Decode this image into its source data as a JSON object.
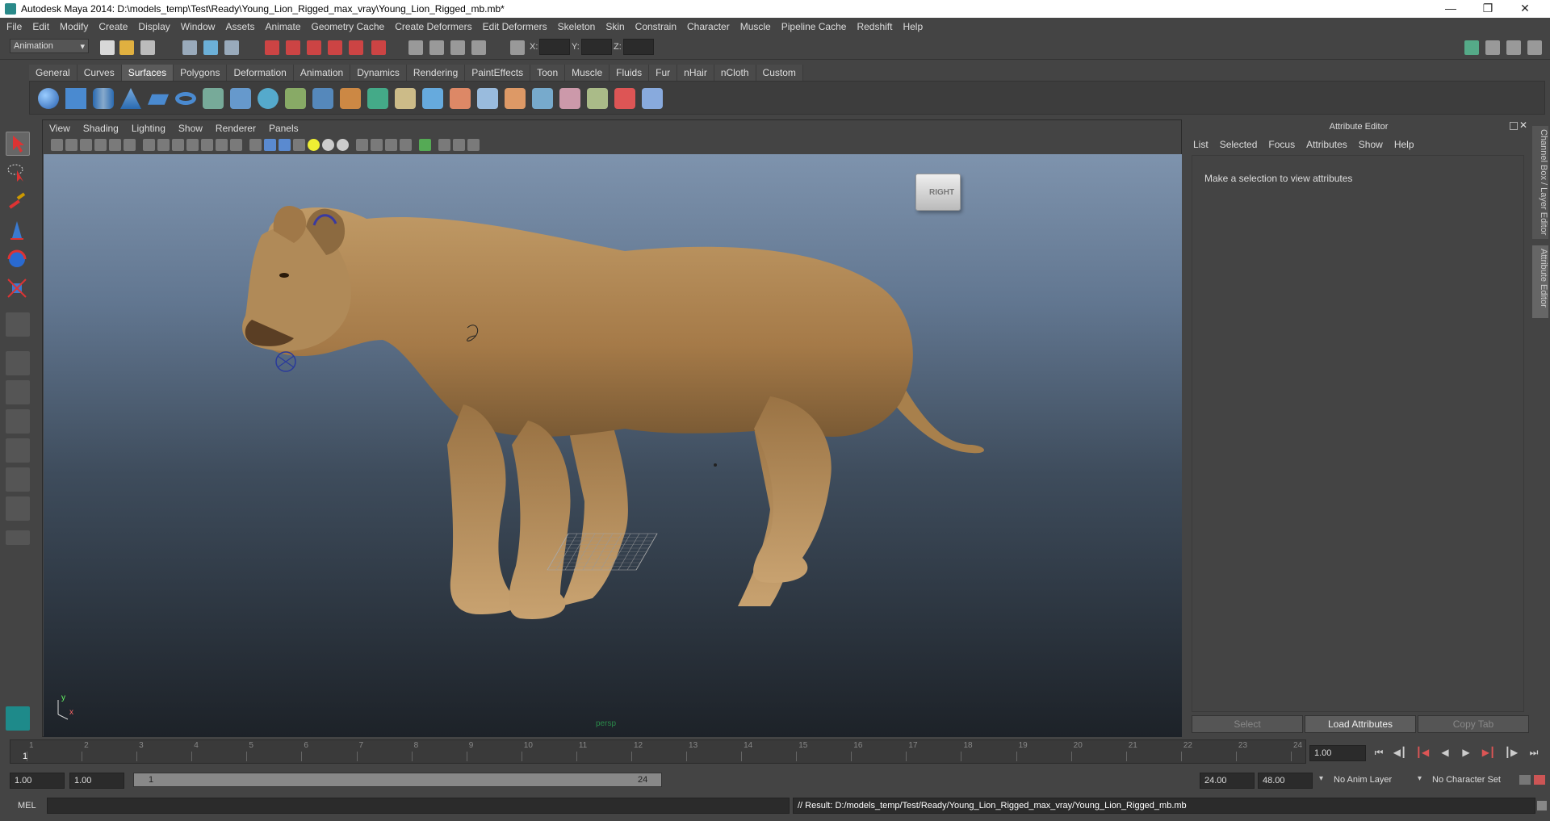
{
  "window": {
    "title": "Autodesk Maya 2014: D:\\models_temp\\Test\\Ready\\Young_Lion_Rigged_max_vray\\Young_Lion_Rigged_mb.mb*"
  },
  "menubar": [
    "File",
    "Edit",
    "Modify",
    "Create",
    "Display",
    "Window",
    "Assets",
    "Animate",
    "Geometry Cache",
    "Create Deformers",
    "Edit Deformers",
    "Skeleton",
    "Skin",
    "Constrain",
    "Character",
    "Muscle",
    "Pipeline Cache",
    "Redshift",
    "Help"
  ],
  "statusline": {
    "mode": "Animation",
    "x_label": "X:",
    "y_label": "Y:",
    "z_label": "Z:"
  },
  "shelf": {
    "tabs": [
      "General",
      "Curves",
      "Surfaces",
      "Polygons",
      "Deformation",
      "Animation",
      "Dynamics",
      "Rendering",
      "PaintEffects",
      "Toon",
      "Muscle",
      "Fluids",
      "Fur",
      "nHair",
      "nCloth",
      "Custom"
    ],
    "active_tab": "Surfaces"
  },
  "viewport": {
    "menu": [
      "View",
      "Shading",
      "Lighting",
      "Show",
      "Renderer",
      "Panels"
    ],
    "camera_label": "persp",
    "viewcube_label": "RIGHT",
    "axis_y": "y",
    "axis_x": "x"
  },
  "attribute_editor": {
    "title": "Attribute Editor",
    "menu": [
      "List",
      "Selected",
      "Focus",
      "Attributes",
      "Show",
      "Help"
    ],
    "message": "Make a selection to view attributes",
    "buttons": {
      "select": "Select",
      "load": "Load Attributes",
      "copy": "Copy Tab"
    }
  },
  "side_tabs": {
    "channel_box": "Channel Box / Layer Editor",
    "attribute_editor": "Attribute Editor"
  },
  "timeslider": {
    "ticks": [
      "1",
      "2",
      "3",
      "4",
      "5",
      "6",
      "7",
      "8",
      "9",
      "10",
      "11",
      "12",
      "13",
      "14",
      "15",
      "16",
      "17",
      "18",
      "19",
      "20",
      "21",
      "22",
      "23",
      "24"
    ],
    "current_frame": "1",
    "current_frame_field": "1.00"
  },
  "range": {
    "start_time": "1.00",
    "playback_start": "1.00",
    "bar_start": "1",
    "bar_end": "24",
    "playback_end": "24.00",
    "end_time": "48.00",
    "anim_layer": "No Anim Layer",
    "character_set": "No Character Set"
  },
  "command_line": {
    "label": "MEL",
    "result": "// Result: D:/models_temp/Test/Ready/Young_Lion_Rigged_max_vray/Young_Lion_Rigged_mb.mb"
  }
}
